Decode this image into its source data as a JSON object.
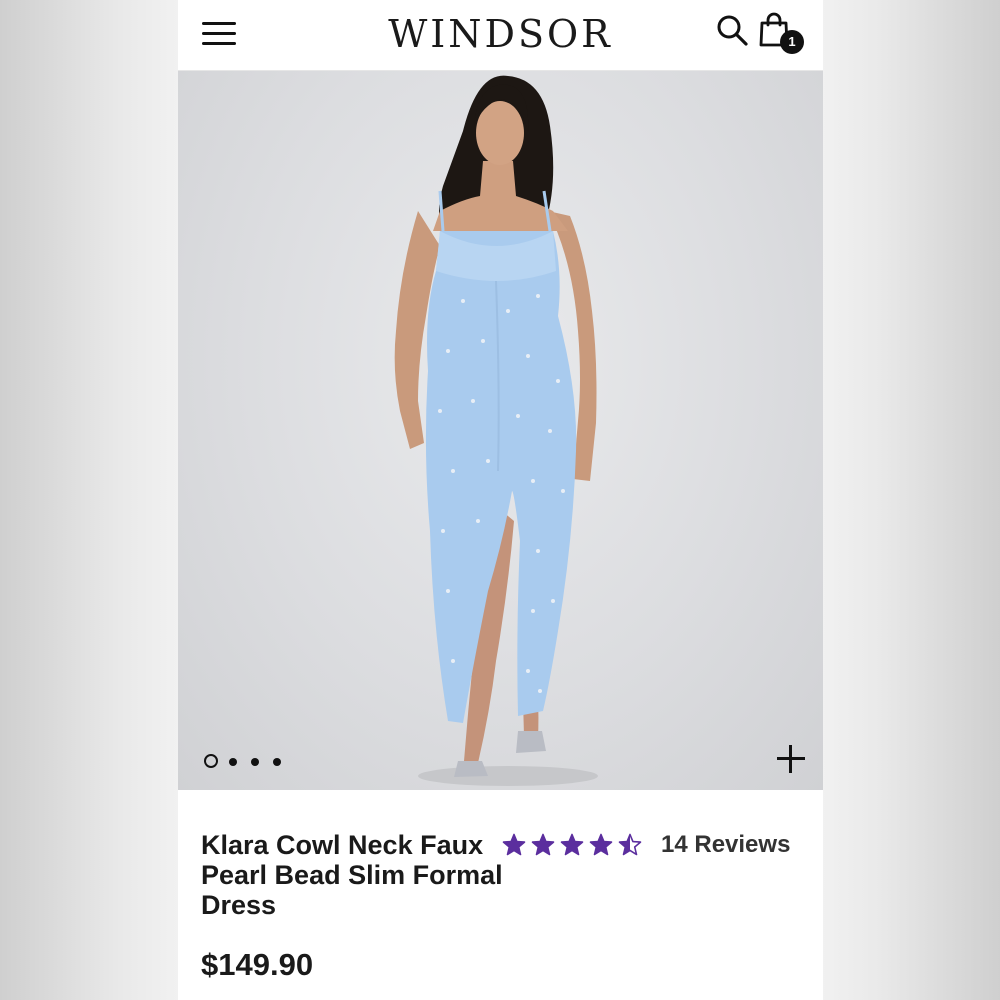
{
  "header": {
    "logo": "WINDSOR",
    "menu_icon": "hamburger-menu-icon",
    "search_icon": "search-icon",
    "cart_icon": "shopping-bag-icon",
    "cart_count": "1"
  },
  "gallery": {
    "image_count": 4,
    "active_index": 0,
    "zoom_icon": "plus-icon",
    "dress_color": "#a9cbee"
  },
  "product": {
    "name": "Klara Cowl Neck Faux Pearl Bead Slim Formal Dress",
    "rating": 4.5,
    "rating_max": 5,
    "reviews_label": "14 Reviews",
    "price": "$149.90"
  },
  "colors": {
    "star": "#5b2e9e",
    "text": "#1a1a1a"
  }
}
